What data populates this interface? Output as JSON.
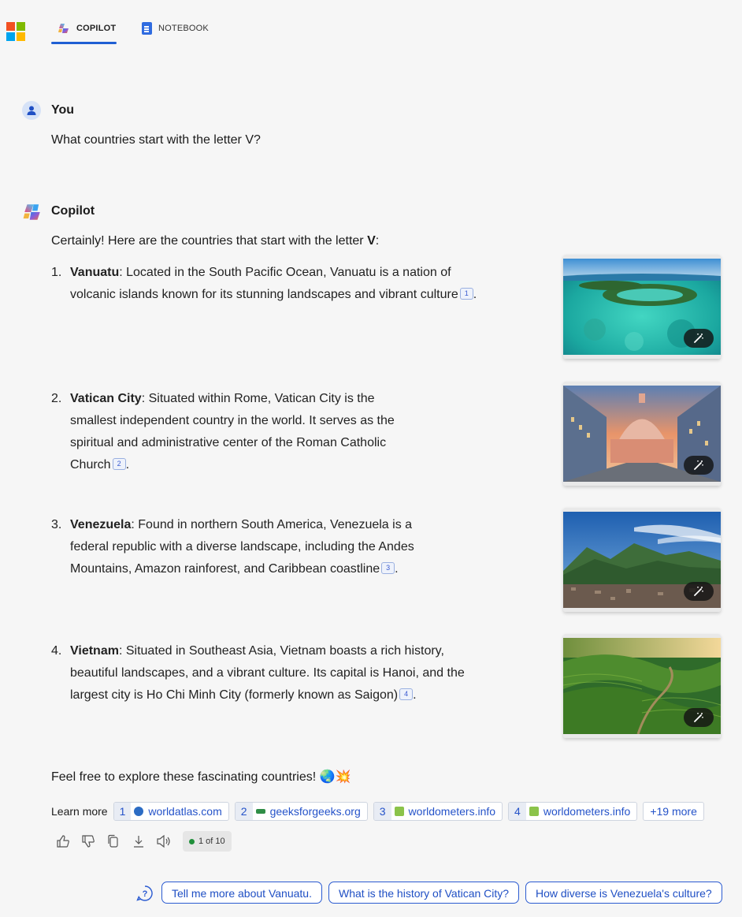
{
  "header": {
    "tabs": [
      {
        "label": "COPILOT",
        "icon": "copilot-logo-icon",
        "active": true
      },
      {
        "label": "NOTEBOOK",
        "icon": "notebook-icon",
        "active": false
      }
    ],
    "logo": "microsoft-logo-icon"
  },
  "user_message": {
    "speaker": "You",
    "text": "What countries start with the letter V?"
  },
  "copilot_message": {
    "speaker": "Copilot",
    "intro_prefix": "Certainly! Here are the countries that start with the letter ",
    "intro_bold": "V",
    "intro_suffix": ":",
    "items": [
      {
        "num": "1.",
        "name": "Vanuatu",
        "text": ": Located in the South Pacific Ocean, Vanuatu is a nation of volcanic islands known for its stunning landscapes and vibrant culture",
        "cite": "1",
        "end": "."
      },
      {
        "num": "2.",
        "name": "Vatican City",
        "text": ": Situated within Rome, Vatican City is the smallest independent country in the world. It serves as the spiritual and administrative center of the Roman Catholic Church",
        "cite": "2",
        "end": "."
      },
      {
        "num": "3.",
        "name": "Venezuela",
        "text": ": Found in northern South America, Venezuela is a federal republic with a diverse landscape, including the Andes Mountains, Amazon rainforest, and Caribbean coastline",
        "cite": "3",
        "end": "."
      },
      {
        "num": "4.",
        "name": "Vietnam",
        "text": ": Situated in Southeast Asia, Vietnam boasts a rich history, beautiful landscapes, and a vibrant culture. Its capital is Hanoi, and the largest city is Ho Chi Minh City (formerly known as Saigon)",
        "cite": "4",
        "end": "."
      }
    ],
    "closing": "Feel free to explore these fascinating countries! 🌏💥"
  },
  "learn_more": {
    "label": "Learn more",
    "sources": [
      {
        "num": "1",
        "site": "worldatlas.com",
        "favicon_color": "#2c6cc4"
      },
      {
        "num": "2",
        "site": "geeksforgeeks.org",
        "favicon_color": "#2f8d46"
      },
      {
        "num": "3",
        "site": "worldometers.info",
        "favicon_color": "#8bc34a"
      },
      {
        "num": "4",
        "site": "worldometers.info",
        "favicon_color": "#8bc34a"
      }
    ],
    "more": "+19 more"
  },
  "feedback": {
    "icons": [
      "thumbs-up-icon",
      "thumbs-down-icon",
      "copy-icon",
      "download-icon",
      "speaker-icon"
    ],
    "pager": "1 of 10"
  },
  "suggestions": [
    "Tell me more about Vanuatu.",
    "What is the history of Vatican City?",
    "How diverse is Venezuela's culture?"
  ],
  "colors": {
    "accent": "#1f5fd3",
    "background": "#f6f6f6",
    "link": "#2553c9"
  }
}
